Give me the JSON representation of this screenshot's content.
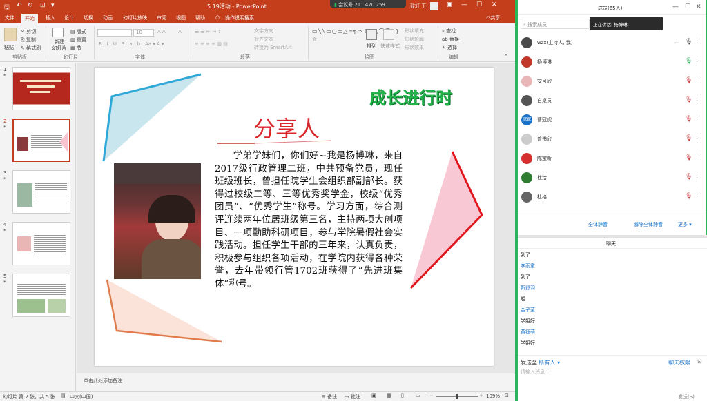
{
  "ppt": {
    "doc_title": "5.19活动  -  PowerPoint",
    "meeting_pill": "会议号 211 470 259",
    "user_name": "鼓轩 王",
    "share_label": "共享",
    "tabs": [
      "文件",
      "开始",
      "插入",
      "设计",
      "切换",
      "动画",
      "幻灯片放映",
      "审阅",
      "视图",
      "帮助"
    ],
    "tell_me": "操作说明搜索",
    "ribbon": {
      "paste": "粘贴",
      "cut": "剪切",
      "copy": "复制",
      "format_painter": "格式刷",
      "clipboard": "剪贴板",
      "new_slide": "新建\n幻灯片",
      "layout": "版式",
      "reset": "重置",
      "section": "节",
      "slides": "幻灯片",
      "font": "字体",
      "font_size": "18",
      "text_direction": "文字方向",
      "align_text": "对齐文本",
      "smartart": "转换为 SmartArt",
      "paragraph": "段落",
      "arrange": "排列",
      "quick_styles": "快速样式",
      "shape_fill": "形状填充",
      "shape_outline": "形状轮廓",
      "shape_effects": "形状效果",
      "drawing": "绘图",
      "find": "查找",
      "replace": "替换",
      "select": "选择",
      "editing": "编辑"
    },
    "thumbnails": [
      {
        "num": "1",
        "star": "*"
      },
      {
        "num": "2",
        "star": "*"
      },
      {
        "num": "3",
        "star": "*"
      },
      {
        "num": "4",
        "star": "*"
      },
      {
        "num": "5",
        "star": "*"
      }
    ],
    "slide": {
      "banner": "成长进行时",
      "heading": "分享人",
      "body": "学弟学妹们，你们好~我是杨博琳，来自2017级行政管理二班，中共预备党员，现任班级班长，曾担任院学生会组织部副部长。获得过校级二等、三等优秀奖学金，校级“优秀团员”、“优秀学生”称号。学习方面，综合测评连续两年位居班级第三名，主持两项大创项目、一项勤助科研项目，参与学院暑假社会实践活动。担任学生干部的三年来，认真负责，积极参与组织各项活动，在学院内获得各种荣誉，去年带领行管1702班获得了“先进班集体”称号。"
    },
    "notes_placeholder": "单击此处添加备注",
    "status": {
      "slide_info": "幻灯片 第 2 张，共 5 张",
      "language": "中文(中国)",
      "notes_btn": "备注",
      "comments_btn": "批注",
      "zoom": "109%"
    }
  },
  "members_panel": {
    "title": "成员(65人)",
    "search_placeholder": "搜索成员",
    "speaking_tooltip": "正在讲话: 杨博琳;",
    "members": [
      {
        "name": "wzx(主持人, 我)",
        "avatar": "",
        "color": "#4a4a4a"
      },
      {
        "name": "杨博琳",
        "avatar": "",
        "color": "#c0392b"
      },
      {
        "name": "安可欣",
        "avatar": "",
        "color": "#e8b6b6"
      },
      {
        "name": "白桌员",
        "avatar": "",
        "color": "#555"
      },
      {
        "name": "曹冠妮",
        "avatar": "冠妮",
        "color": "#1a73c9"
      },
      {
        "name": "曾书欣",
        "avatar": "",
        "color": "#ccc"
      },
      {
        "name": "陈宝昕",
        "avatar": "",
        "color": "#d32f2f"
      },
      {
        "name": "杜洽",
        "avatar": "",
        "color": "#2e7d32"
      },
      {
        "name": "杜格",
        "avatar": "",
        "color": "#666"
      }
    ],
    "mute_all": "全体静音",
    "unmute_all": "解除全体静音",
    "more": "更多"
  },
  "chat_panel": {
    "title": "聊天",
    "messages": [
      {
        "type": "msg",
        "text": "到了"
      },
      {
        "type": "name",
        "text": "李雨童"
      },
      {
        "type": "msg",
        "text": "到了"
      },
      {
        "type": "name",
        "text": "靳舒羽"
      },
      {
        "type": "msg",
        "text": "船"
      },
      {
        "type": "name",
        "text": "金子莹"
      },
      {
        "type": "msg",
        "text": "学姐好"
      },
      {
        "type": "name",
        "text": "黄钰萌"
      },
      {
        "type": "msg",
        "text": "学姐好"
      }
    ],
    "send_to_label": "发送至",
    "send_to_value": "所有人",
    "permission": "聊天权限",
    "input_placeholder": "请输入消息...",
    "send_btn": "发送(S)"
  },
  "colors": {
    "ppt_red": "#c43e1c",
    "meeting_green": "#2db45e",
    "link_blue": "#1a73c9"
  }
}
